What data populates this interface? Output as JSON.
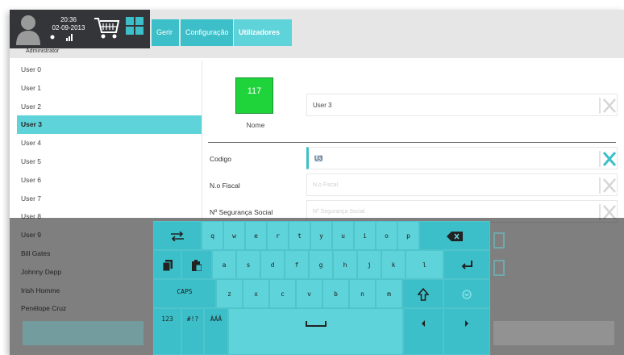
{
  "header": {
    "time": "20:36",
    "date": "02-09-2013",
    "role": "Administrator",
    "tabs": [
      {
        "label": "Gerir"
      },
      {
        "label": "Configuração"
      },
      {
        "label": "Utilizadores",
        "active": true
      }
    ]
  },
  "user_list": [
    "User 0",
    "User 1",
    "User 2",
    "User 3",
    "User 4",
    "User 5",
    "User 6",
    "User 7",
    "User 8",
    "User 9",
    "Bill Gates",
    "Johnny Depp",
    "Irish Homme",
    "Penélope Cruz"
  ],
  "selected_user": "User 3",
  "form": {
    "number": "117",
    "number_color": "#1ed43a",
    "nome_label": "Nome",
    "nome_value": "User 3",
    "codigo_label": "Codigo",
    "codigo_value": "U3",
    "nif_label": "N.o Fiscal",
    "nif_placeholder": "N.o Fiscal",
    "nss_label": "Nº Segurança Social",
    "nss_placeholder": "Nº Segurança Social"
  },
  "keyboard": {
    "row1": [
      "q",
      "w",
      "e",
      "r",
      "t",
      "y",
      "u",
      "i",
      "o",
      "p"
    ],
    "row2": [
      "a",
      "s",
      "d",
      "f",
      "g",
      "h",
      "j",
      "k",
      "l"
    ],
    "row3": [
      "z",
      "x",
      "c",
      "v",
      "b",
      "n",
      "m"
    ],
    "caps_label": "CAPS",
    "num_label": "123",
    "sym_label": "#!?",
    "accent_label": "ÀÁÂ"
  },
  "colors": {
    "accent": "#3cbfc9",
    "accent_light": "#5fd3da",
    "header_dark": "#333538"
  }
}
